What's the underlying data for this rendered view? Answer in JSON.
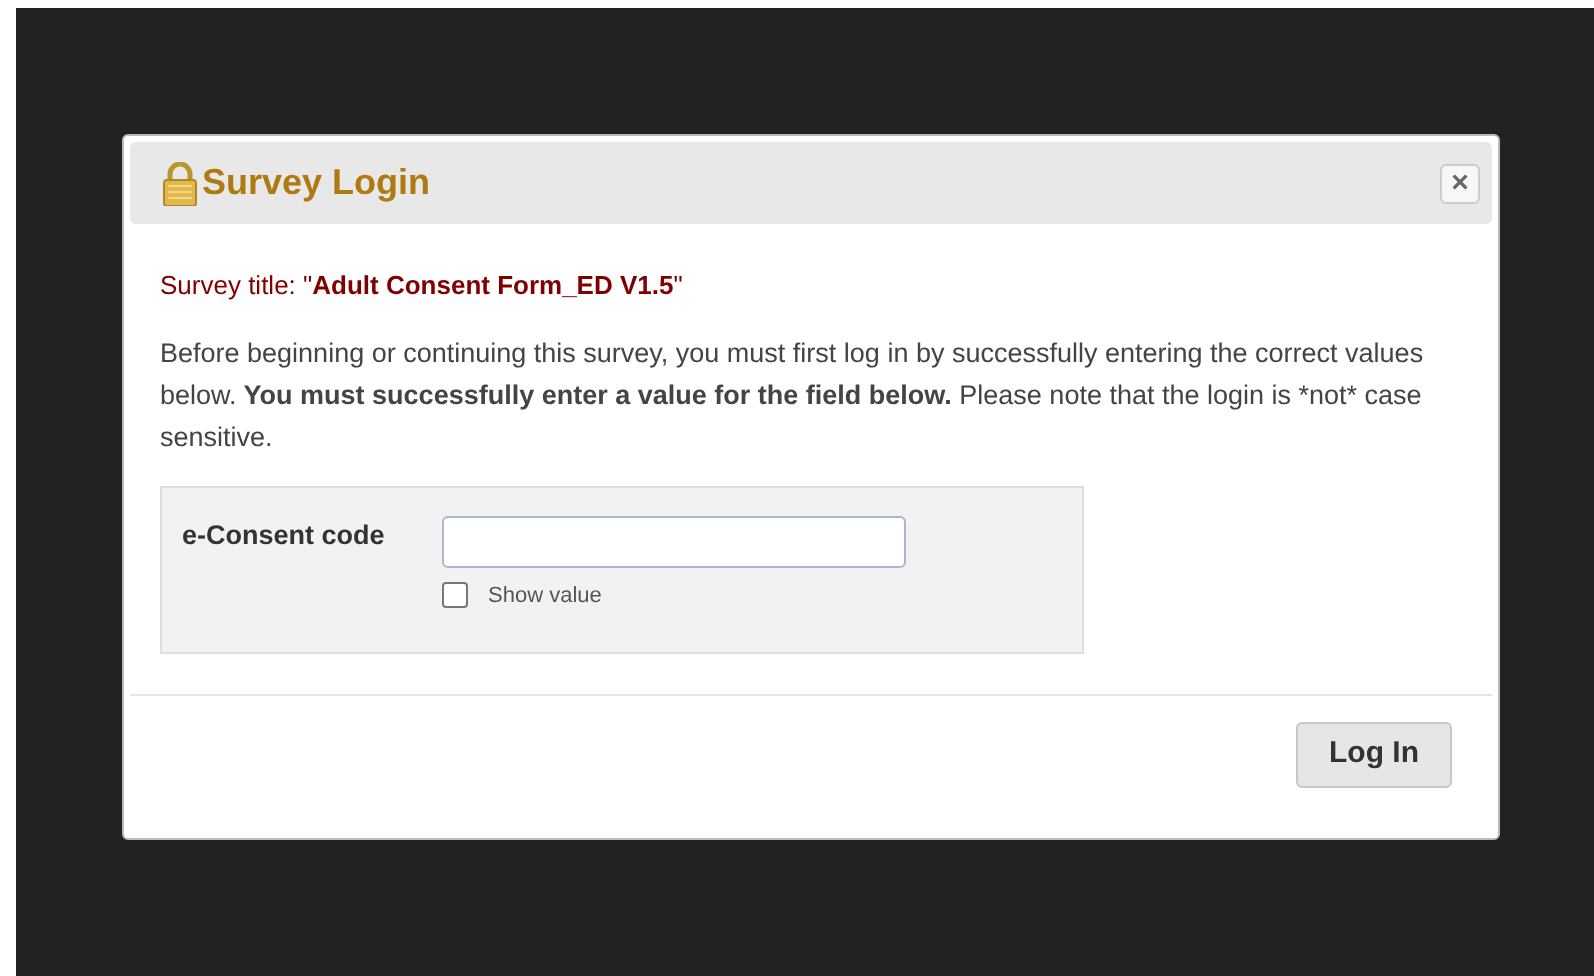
{
  "dialog": {
    "title": "Survey Login",
    "close": "×",
    "survey_title": "Survey title: \"**Adult Consent Form_ED V1.5**\"",
    "instructions": [
      {
        "text": "Before beginning or continuing this survey, you must first log in by successfully entering the correct values below.",
        "bold": false
      },
      {
        "text": "You must successfully enter a value for the field below.",
        "bold": true
      },
      {
        "text": "Please note that the login is *not* case sensitive.",
        "bold": false
      }
    ],
    "field": {
      "label": "e-Consent code",
      "show_value": {
        "label": "Show value",
        "checked": false
      }
    },
    "button": "Log In"
  }
}
